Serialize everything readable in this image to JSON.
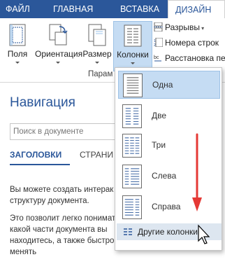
{
  "tabs": {
    "file": "ФАЙЛ",
    "home": "ГЛАВНАЯ",
    "insert": "ВСТАВКА",
    "design": "ДИЗАЙН"
  },
  "ribbon": {
    "fields": "Поля",
    "orientation": "Ориентация",
    "size": "Размер",
    "columns": "Колонки",
    "breaks": "Разрывы",
    "line_numbers": "Номера строк",
    "hyphenation": "Расстановка пе",
    "group_label": "Парам"
  },
  "navigation": {
    "title": "Навигация",
    "search_placeholder": "Поиск в документе",
    "tab_headings": "ЗАГОЛОВКИ",
    "tab_pages": "СТРАНИ",
    "text1": "Вы можете создать интерак структуру документа.",
    "text2": "Это позволит легко понимат какой части документа вы находитесь, а также быстро менять"
  },
  "columns_menu": {
    "items": [
      {
        "label": "Одна"
      },
      {
        "label": "Две"
      },
      {
        "label": "Три"
      },
      {
        "label": "Слева"
      },
      {
        "label": "Справа"
      }
    ],
    "more": "Другие колонки..."
  },
  "colors": {
    "accent": "#2b579a",
    "selected": "#c5dcf3",
    "arrow": "#e53935"
  }
}
